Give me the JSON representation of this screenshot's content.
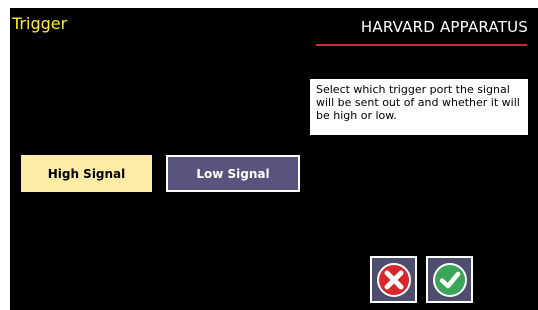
{
  "screen": {
    "title": "Trigger",
    "brand": "HARVARD APPARATUS",
    "info_text": "Select which trigger port the signal will be sent out of and whether it will be high or low."
  },
  "buttons": {
    "high_signal": "High Signal",
    "low_signal": "Low Signal"
  },
  "actions": {
    "cancel_icon": "x-circle-icon",
    "confirm_icon": "check-circle-icon"
  },
  "colors": {
    "title": "#ffee33",
    "brand_underline": "#d9272e",
    "high_signal_bg": "#fdeba6",
    "low_signal_bg": "#59547d",
    "cancel": "#d9272e",
    "confirm": "#3aa65a"
  }
}
